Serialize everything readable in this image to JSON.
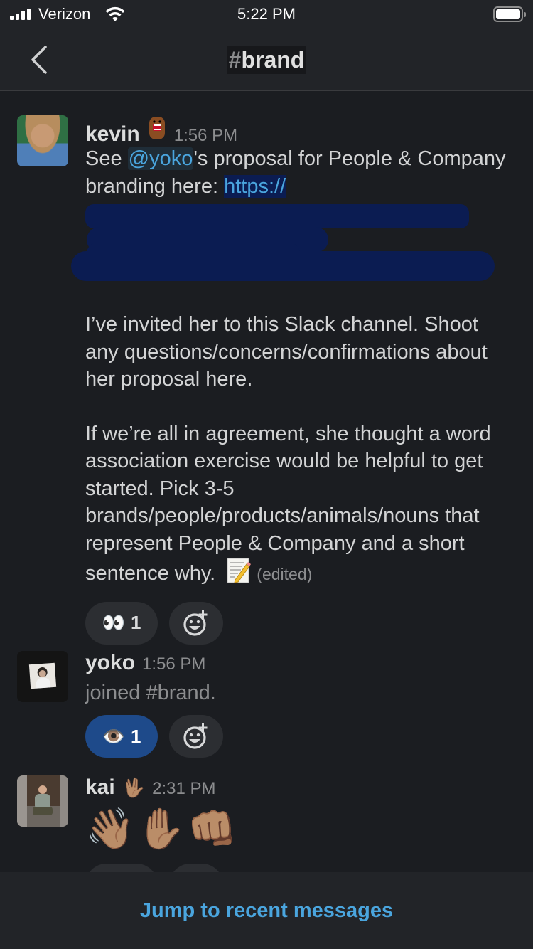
{
  "status_bar": {
    "carrier": "Verizon",
    "time": "5:22 PM",
    "signal_bars": 4,
    "battery_level": 0.95
  },
  "header": {
    "back_icon": "chevron-left-icon",
    "channel_prefix": "#",
    "channel_name": "brand"
  },
  "colors": {
    "background": "#1b1d21",
    "link": "#4aa5de",
    "active_reaction": "#1e4a8a",
    "reaction": "#2c2e32",
    "redaction": "#0b1c52"
  },
  "messages": [
    {
      "author": "kevin",
      "status_emoji": "🐻",
      "status_emoji_name": "domo-kun-emoji",
      "time": "1:56 PM",
      "text_before_mention": "See ",
      "mention": "@yoko",
      "text_after_mention": "'s proposal for People & Company branding here: ",
      "link_visible": "https://",
      "link_redacted": true,
      "paragraph2": "I’ve invited her to this Slack channel. Shoot any questions/concerns/confirmations about her proposal here.",
      "paragraph3": "If we’re all in agreement, she thought a word association exercise would be helpful to get started. Pick 3-5 brands/people/products/animals/nouns that represent People & Company and a short sentence why.",
      "trailing_emoji": "📝",
      "edited_label": "(edited)",
      "reactions": [
        {
          "emoji": "👀",
          "name": "eyes",
          "count": "1",
          "active": false
        }
      ]
    },
    {
      "author": "yoko",
      "time": "1:56 PM",
      "system_text": "joined #brand.",
      "reactions": [
        {
          "emoji": "👁️",
          "name": "eye",
          "count": "1",
          "active": true
        }
      ]
    },
    {
      "author": "kai",
      "status_emoji": "🖖🏽",
      "time": "2:31 PM",
      "emoji_text": "👋🏽✋🏽👊🏽"
    }
  ],
  "add_reaction_icon": "☺+",
  "footer": {
    "jump_label": "Jump to recent messages"
  }
}
